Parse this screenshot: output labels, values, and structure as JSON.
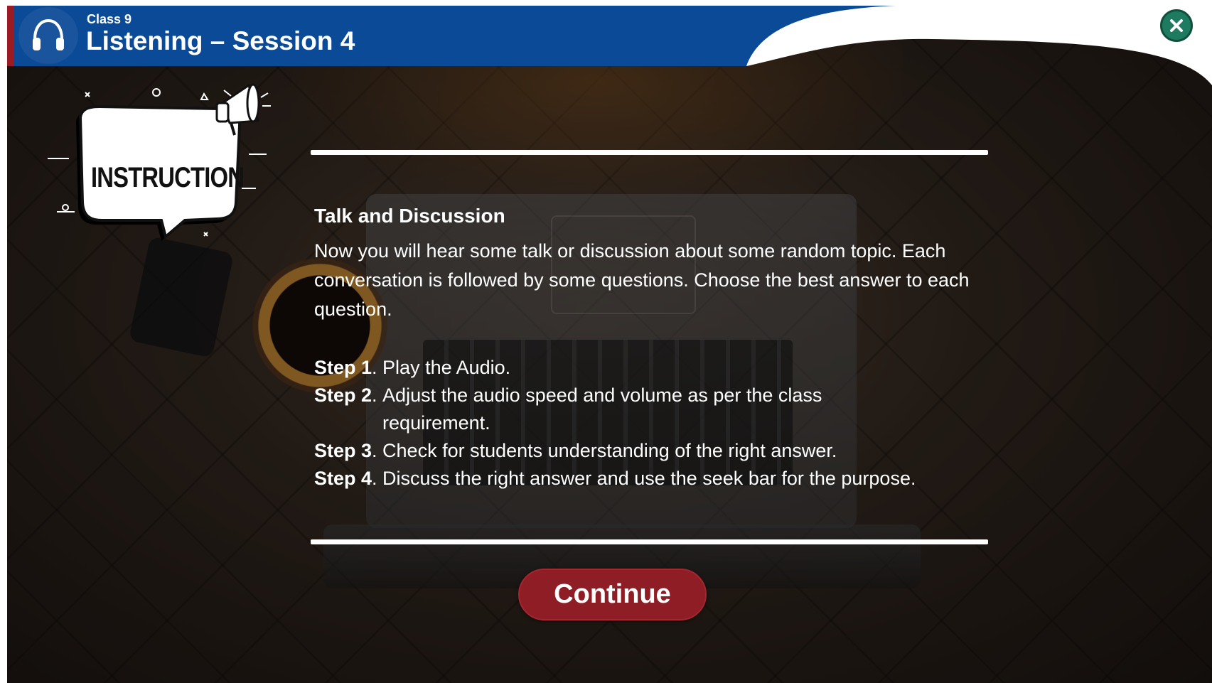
{
  "header": {
    "class_label": "Class 9",
    "title": "Listening – Session 4",
    "icon": "headphones-icon"
  },
  "close_button": {
    "icon": "close-icon"
  },
  "badge": {
    "label": "INSTRUCTION",
    "icon": "megaphone-icon"
  },
  "content": {
    "heading": "Talk and Discussion",
    "paragraph": "Now you will hear some talk or discussion about some random topic. Each conversation is followed by some questions. Choose the best answer to each question.",
    "steps": [
      {
        "label": "Step 1",
        "text": "Play the Audio."
      },
      {
        "label": "Step 2",
        "text": "Adjust the audio speed and volume as per the class requirement."
      },
      {
        "label": "Step 3",
        "text": "Check for students understanding of the right answer."
      },
      {
        "label": "Step 4",
        "text": "Discuss the right answer and use the seek bar for the purpose."
      }
    ]
  },
  "continue_button": {
    "label": "Continue"
  },
  "colors": {
    "header_blue": "#0b4a97",
    "accent_red": "#8e1d25",
    "close_green": "#1e7b5f"
  }
}
